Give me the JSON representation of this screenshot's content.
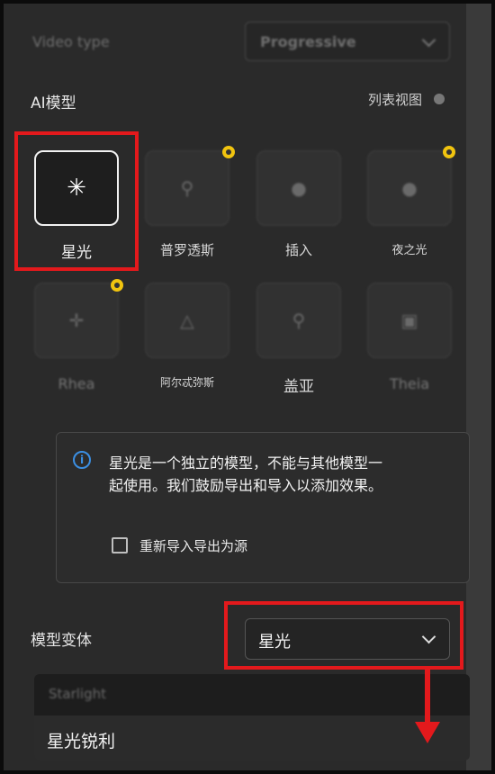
{
  "video_type": {
    "label": "Video type",
    "value": "Progressive"
  },
  "ai_model": {
    "title": "AI模型",
    "list_view": "列表视图",
    "models": [
      {
        "name": "星光",
        "icon": "sparkle-icon",
        "selected": true,
        "premium": false
      },
      {
        "name": "普罗透斯",
        "icon": "magnifier-icon",
        "selected": false,
        "premium": true
      },
      {
        "name": "插入",
        "icon": "circle-icon",
        "selected": false,
        "premium": false
      },
      {
        "name": "夜之光",
        "icon": "circle-icon",
        "selected": false,
        "premium": true
      },
      {
        "name": "Rhea",
        "icon": "crosshair-icon",
        "selected": false,
        "premium": true
      },
      {
        "name": "阿尔忒弥斯",
        "icon": "triangle-icon",
        "selected": false,
        "premium": false
      },
      {
        "name": "盖亚",
        "icon": "location-icon",
        "selected": false,
        "premium": false
      },
      {
        "name": "Theia",
        "icon": "image-icon",
        "selected": false,
        "premium": false
      }
    ]
  },
  "info": {
    "message_line1": "星光是一个独立的模型，不能与其他模型一",
    "message_line2": "起使用。我们鼓励导出和导入以添加效果。",
    "checkbox_label": "重新导入导出为源",
    "checked": false
  },
  "variant": {
    "label": "模型变体",
    "value": "星光",
    "options": [
      "Starlight",
      "星光锐利"
    ]
  },
  "colors": {
    "highlight": "#e3191c",
    "badge": "#f1c40f",
    "info_icon": "#3b8fe3"
  }
}
